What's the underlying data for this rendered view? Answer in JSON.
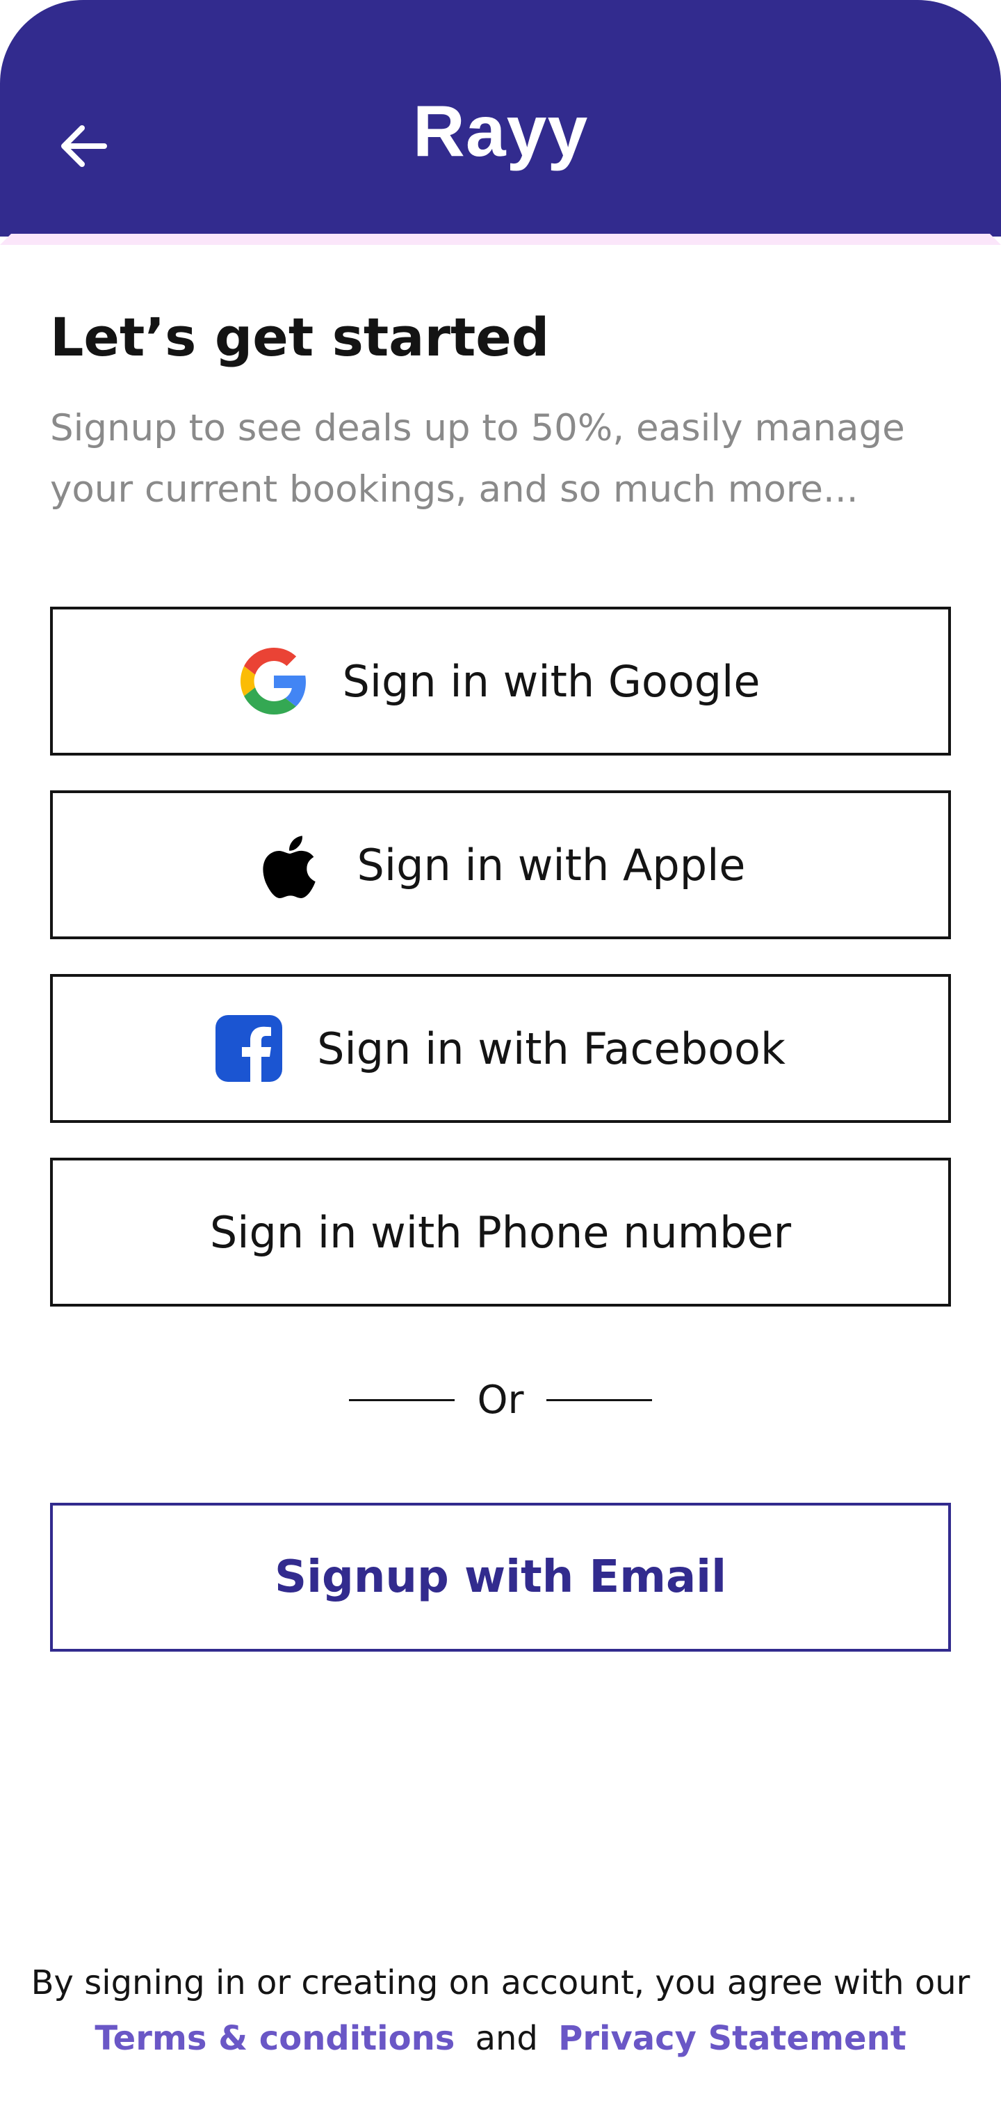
{
  "header": {
    "brand": "Rayy",
    "back_icon": "arrow-left-icon",
    "background_color": "#322b8e"
  },
  "intro": {
    "title": "Let’s get started",
    "subtitle": "Signup to see deals up to 50%, easily manage your current bookings, and so much more..."
  },
  "buttons": {
    "google": {
      "label": "Sign in with Google",
      "icon": "google-icon"
    },
    "apple": {
      "label": "Sign in with Apple",
      "icon": "apple-icon"
    },
    "facebook": {
      "label": "Sign in with Facebook",
      "icon": "facebook-icon"
    },
    "phone": {
      "label": "Sign in with Phone number"
    }
  },
  "divider": {
    "label": "Or"
  },
  "email_signup": {
    "label": "Signup with Email",
    "color": "#322b8e"
  },
  "footer": {
    "text": "By signing in or creating on account, you agree with our",
    "terms_link": "Terms & conditions",
    "joiner": "and",
    "privacy_link": "Privacy Statement",
    "link_color": "#6a57c6"
  }
}
